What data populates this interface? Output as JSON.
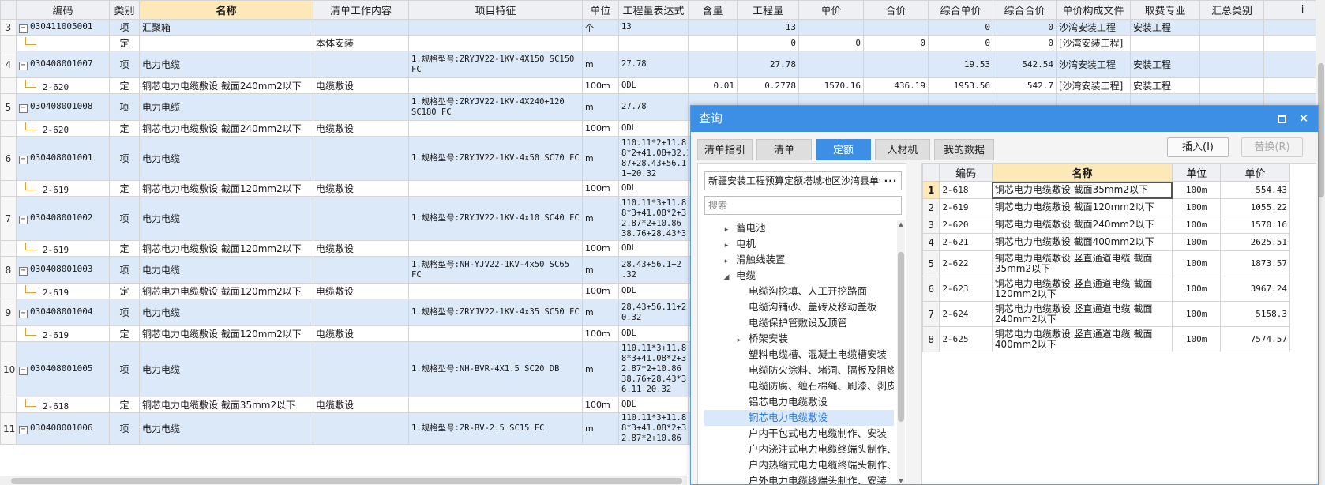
{
  "main_table": {
    "headers": [
      {
        "label": "",
        "hl": false
      },
      {
        "label": "编码",
        "hl": false
      },
      {
        "label": "类别",
        "hl": false
      },
      {
        "label": "名称",
        "hl": true
      },
      {
        "label": "清单工作内容",
        "hl": false
      },
      {
        "label": "项目特征",
        "hl": false
      },
      {
        "label": "单位",
        "hl": false
      },
      {
        "label": "工程量表达式",
        "hl": false
      },
      {
        "label": "含量",
        "hl": false
      },
      {
        "label": "工程量",
        "hl": false
      },
      {
        "label": "单价",
        "hl": false
      },
      {
        "label": "合价",
        "hl": false
      },
      {
        "label": "综合单价",
        "hl": false
      },
      {
        "label": "综合合价",
        "hl": false
      },
      {
        "label": "单价构成文件",
        "hl": false
      },
      {
        "label": "取费专业",
        "hl": false
      },
      {
        "label": "汇总类别",
        "hl": false
      },
      {
        "label": "i",
        "hl": false
      }
    ],
    "rows": [
      {
        "kind": "item",
        "rn": "3",
        "code": "030411005001",
        "cat": "项",
        "name": "汇聚箱",
        "work": "",
        "feature": "",
        "unit": "个",
        "expr": "13",
        "qty_ratio": "",
        "qty": "13",
        "price": "",
        "total": "",
        "comp_price": "0",
        "comp_total": "0",
        "file": "沙湾安装工程",
        "spec": "安装工程",
        "sum": ""
      },
      {
        "kind": "sub",
        "rn": "",
        "code": "",
        "cat": "定",
        "name": "",
        "work": "本体安装",
        "feature": "",
        "unit": "",
        "expr": "",
        "qty_ratio": "",
        "qty": "0",
        "price": "0",
        "total": "0",
        "comp_price": "0",
        "comp_total": "0",
        "file": "[沙湾安装工程]",
        "spec": "",
        "sum": ""
      },
      {
        "kind": "item",
        "rn": "4",
        "code": "030408001007",
        "cat": "项",
        "name": "电力电缆",
        "work": "",
        "feature": "1.规格型号:ZRYJV22-1KV-4X150 SC150 FC",
        "unit": "m",
        "expr": "27.78",
        "qty_ratio": "",
        "qty": "27.78",
        "price": "",
        "total": "",
        "comp_price": "19.53",
        "comp_total": "542.54",
        "file": "沙湾安装工程",
        "spec": "安装工程",
        "sum": ""
      },
      {
        "kind": "sub",
        "rn": "",
        "code": "2-620",
        "cat": "定",
        "name": "铜芯电力电缆敷设 截面240mm2以下",
        "work": "电缆敷设",
        "feature": "",
        "unit": "100m",
        "expr": "QDL",
        "qty_ratio": "0.01",
        "qty": "0.2778",
        "price": "1570.16",
        "total": "436.19",
        "comp_price": "1953.56",
        "comp_total": "542.7",
        "file": "[沙湾安装工程]",
        "spec": "安装工程",
        "sum": ""
      },
      {
        "kind": "item",
        "rn": "5",
        "code": "030408001008",
        "cat": "项",
        "name": "电力电缆",
        "work": "",
        "feature": "1.规格型号:ZRYJV22-1KV-4X240+120 SC180 FC",
        "unit": "m",
        "expr": "27.78",
        "qty_ratio": "",
        "qty": "",
        "price": "",
        "total": "",
        "comp_price": "",
        "comp_total": "",
        "file": "",
        "spec": "",
        "sum": ""
      },
      {
        "kind": "sub",
        "rn": "",
        "code": "2-620",
        "cat": "定",
        "name": "铜芯电力电缆敷设 截面240mm2以下",
        "work": "电缆敷设",
        "feature": "",
        "unit": "100m",
        "expr": "QDL",
        "qty_ratio": "",
        "qty": "",
        "price": "",
        "total": "",
        "comp_price": "",
        "comp_total": "",
        "file": "",
        "spec": "",
        "sum": ""
      },
      {
        "kind": "item",
        "rn": "6",
        "code": "030408001001",
        "cat": "项",
        "name": "电力电缆",
        "work": "",
        "feature": "1.规格型号:ZRYJV22-1KV-4x50 SC70 FC",
        "unit": "m",
        "expr": "110.11*2+11.8 8*2+41.08+32.1 87+28.43+56.1 1+20.32",
        "qty_ratio": "",
        "qty": "",
        "price": "",
        "total": "",
        "comp_price": "",
        "comp_total": "",
        "file": "",
        "spec": "",
        "sum": ""
      },
      {
        "kind": "sub",
        "rn": "",
        "code": "2-619",
        "cat": "定",
        "name": "铜芯电力电缆敷设 截面120mm2以下",
        "work": "电缆敷设",
        "feature": "",
        "unit": "100m",
        "expr": "QDL",
        "qty_ratio": "",
        "qty": "",
        "price": "",
        "total": "",
        "comp_price": "",
        "comp_total": "",
        "file": "",
        "spec": "",
        "sum": ""
      },
      {
        "kind": "item",
        "rn": "7",
        "code": "030408001002",
        "cat": "项",
        "name": "电力电缆",
        "work": "",
        "feature": "1.规格型号:ZRYJV22-1KV-4x10 SC40 FC",
        "unit": "m",
        "expr": "110.11*3+11.8 8*3+41.08*2+3 2.87*2+10.86 38.76+28.43*3",
        "qty_ratio": "",
        "qty": "",
        "price": "",
        "total": "",
        "comp_price": "",
        "comp_total": "",
        "file": "",
        "spec": "",
        "sum": ""
      },
      {
        "kind": "sub",
        "rn": "",
        "code": "2-619",
        "cat": "定",
        "name": "铜芯电力电缆敷设 截面120mm2以下",
        "work": "电缆敷设",
        "feature": "",
        "unit": "100m",
        "expr": "QDL",
        "qty_ratio": "",
        "qty": "",
        "price": "",
        "total": "",
        "comp_price": "",
        "comp_total": "",
        "file": "",
        "spec": "",
        "sum": ""
      },
      {
        "kind": "item",
        "rn": "8",
        "code": "030408001003",
        "cat": "项",
        "name": "电力电缆",
        "work": "",
        "feature": "1.规格型号:NH-YJV22-1KV-4x50 SC65 FC",
        "unit": "m",
        "expr": "28.43+56.1+2 .32",
        "qty_ratio": "",
        "qty": "",
        "price": "",
        "total": "",
        "comp_price": "",
        "comp_total": "",
        "file": "",
        "spec": "",
        "sum": ""
      },
      {
        "kind": "sub",
        "rn": "",
        "code": "2-619",
        "cat": "定",
        "name": "铜芯电力电缆敷设 截面120mm2以下",
        "work": "电缆敷设",
        "feature": "",
        "unit": "100m",
        "expr": "QDL",
        "qty_ratio": "",
        "qty": "",
        "price": "",
        "total": "",
        "comp_price": "",
        "comp_total": "",
        "file": "",
        "spec": "",
        "sum": ""
      },
      {
        "kind": "item",
        "rn": "9",
        "code": "030408001004",
        "cat": "项",
        "name": "电力电缆",
        "work": "",
        "feature": "1.规格型号:ZRYJV22-1KV-4x35 SC50 FC",
        "unit": "m",
        "expr": "28.43+56.11+2 0.32",
        "qty_ratio": "",
        "qty": "",
        "price": "",
        "total": "",
        "comp_price": "",
        "comp_total": "",
        "file": "",
        "spec": "",
        "sum": ""
      },
      {
        "kind": "sub",
        "rn": "",
        "code": "2-619",
        "cat": "定",
        "name": "铜芯电力电缆敷设 截面120mm2以下",
        "work": "电缆敷设",
        "feature": "",
        "unit": "100m",
        "expr": "QDL",
        "qty_ratio": "",
        "qty": "",
        "price": "",
        "total": "",
        "comp_price": "",
        "comp_total": "",
        "file": "",
        "spec": "",
        "sum": ""
      },
      {
        "kind": "item",
        "rn": "10",
        "code": "030408001005",
        "cat": "项",
        "name": "电力电缆",
        "work": "",
        "feature": "1.规格型号:NH-BVR-4X1.5 SC20 DB",
        "unit": "m",
        "expr": "110.11*3+11.8 8*3+41.08*2+3 2.87*2+10.86 38.76+28.43*3 6.11+20.32",
        "qty_ratio": "",
        "qty": "",
        "price": "",
        "total": "",
        "comp_price": "",
        "comp_total": "",
        "file": "",
        "spec": "",
        "sum": ""
      },
      {
        "kind": "sub",
        "rn": "",
        "code": "2-618",
        "cat": "定",
        "name": "铜芯电力电缆敷设 截面35mm2以下",
        "work": "电缆敷设",
        "feature": "",
        "unit": "100m",
        "expr": "QDL",
        "qty_ratio": "",
        "qty": "",
        "price": "",
        "total": "",
        "comp_price": "",
        "comp_total": "",
        "file": "",
        "spec": "",
        "sum": ""
      },
      {
        "kind": "item",
        "rn": "11",
        "code": "030408001006",
        "cat": "项",
        "name": "电力电缆",
        "work": "",
        "feature": "1.规格型号:ZR-BV-2.5 SC15 FC",
        "unit": "m",
        "expr": "110.11*3+11.8 8*3+41.08*2+3 2.87*2+10.86",
        "qty_ratio": "",
        "qty": "",
        "price": "",
        "total": "",
        "comp_price": "",
        "comp_total": "",
        "file": "",
        "spec": "",
        "sum": ""
      }
    ]
  },
  "dialog": {
    "title": "查询",
    "max_icon": "maximize-icon",
    "close_icon": "close-icon",
    "close_glyph": "✕",
    "tabs": [
      {
        "label": "清单指引",
        "active": false
      },
      {
        "label": "清单",
        "active": false
      },
      {
        "label": "定额",
        "active": true
      },
      {
        "label": "人材机",
        "active": false
      },
      {
        "label": "我的数据",
        "active": false
      }
    ],
    "insert_label": "插入(I)",
    "replace_label": "替换(R)",
    "library_value": "新疆安装工程预算定额塔城地区沙湾县单位估价表",
    "library_more": "···",
    "search_placeholder": "搜索",
    "tree": [
      {
        "label": "蓄电池",
        "level": 1,
        "arrow": "▸",
        "selected": false
      },
      {
        "label": "电机",
        "level": 1,
        "arrow": "▸",
        "selected": false
      },
      {
        "label": "滑触线装置",
        "level": 1,
        "arrow": "▸",
        "selected": false
      },
      {
        "label": "电缆",
        "level": 1,
        "arrow": "◢",
        "selected": false
      },
      {
        "label": "电缆沟挖填、人工开挖路面",
        "level": 2,
        "arrow": "",
        "selected": false
      },
      {
        "label": "电缆沟铺砂、盖砖及移动盖板",
        "level": 2,
        "arrow": "",
        "selected": false
      },
      {
        "label": "电缆保护管敷设及顶管",
        "level": 2,
        "arrow": "",
        "selected": false
      },
      {
        "label": "桥架安装",
        "level": 2,
        "arrow": "▸",
        "selected": false
      },
      {
        "label": "塑料电缆槽、混凝土电缆槽安装",
        "level": 2,
        "arrow": "",
        "selected": false
      },
      {
        "label": "电缆防火涂料、堵洞、隔板及阻燃槽盒安装",
        "level": 2,
        "arrow": "",
        "selected": false
      },
      {
        "label": "电缆防腐、缠石棉绳、刷漆、剥皮",
        "level": 2,
        "arrow": "",
        "selected": false
      },
      {
        "label": "铝芯电力电缆敷设",
        "level": 2,
        "arrow": "",
        "selected": false
      },
      {
        "label": "铜芯电力电缆敷设",
        "level": 2,
        "arrow": "",
        "selected": true
      },
      {
        "label": "户内干包式电力电缆制作、安装",
        "level": 2,
        "arrow": "",
        "selected": false
      },
      {
        "label": "户内浇注式电力电缆终端头制作、安装",
        "level": 2,
        "arrow": "",
        "selected": false
      },
      {
        "label": "户内热缩式电力电缆终端头制作、安装",
        "level": 2,
        "arrow": "",
        "selected": false
      },
      {
        "label": "户外电力电缆终端头制作、安装",
        "level": 2,
        "arrow": "",
        "selected": false
      }
    ],
    "result_headers": [
      {
        "label": "",
        "hl": false
      },
      {
        "label": "编码",
        "hl": false
      },
      {
        "label": "名称",
        "hl": true
      },
      {
        "label": "单位",
        "hl": false
      },
      {
        "label": "单价",
        "hl": false
      }
    ],
    "results": [
      {
        "n": "1",
        "code": "2-618",
        "name": "铜芯电力电缆敷设 截面35mm2以下",
        "unit": "100m",
        "price": "554.43",
        "current": true
      },
      {
        "n": "2",
        "code": "2-619",
        "name": "铜芯电力电缆敷设 截面120mm2以下",
        "unit": "100m",
        "price": "1055.22",
        "current": false
      },
      {
        "n": "3",
        "code": "2-620",
        "name": "铜芯电力电缆敷设 截面240mm2以下",
        "unit": "100m",
        "price": "1570.16",
        "current": false
      },
      {
        "n": "4",
        "code": "2-621",
        "name": "铜芯电力电缆敷设 截面400mm2以下",
        "unit": "100m",
        "price": "2625.51",
        "current": false
      },
      {
        "n": "5",
        "code": "2-622",
        "name": "铜芯电力电缆敷设 竖直通道电缆 截面35mm2以下",
        "unit": "100m",
        "price": "1873.57",
        "current": false
      },
      {
        "n": "6",
        "code": "2-623",
        "name": "铜芯电力电缆敷设 竖直通道电缆 截面120mm2以下",
        "unit": "100m",
        "price": "3967.24",
        "current": false
      },
      {
        "n": "7",
        "code": "2-624",
        "name": "铜芯电力电缆敷设 竖直通道电缆 截面240mm2以下",
        "unit": "100m",
        "price": "5158.3",
        "current": false
      },
      {
        "n": "8",
        "code": "2-625",
        "name": "铜芯电力电缆敷设 竖直通道电缆 截面400mm2以下",
        "unit": "100m",
        "price": "7574.57",
        "current": false
      }
    ]
  }
}
